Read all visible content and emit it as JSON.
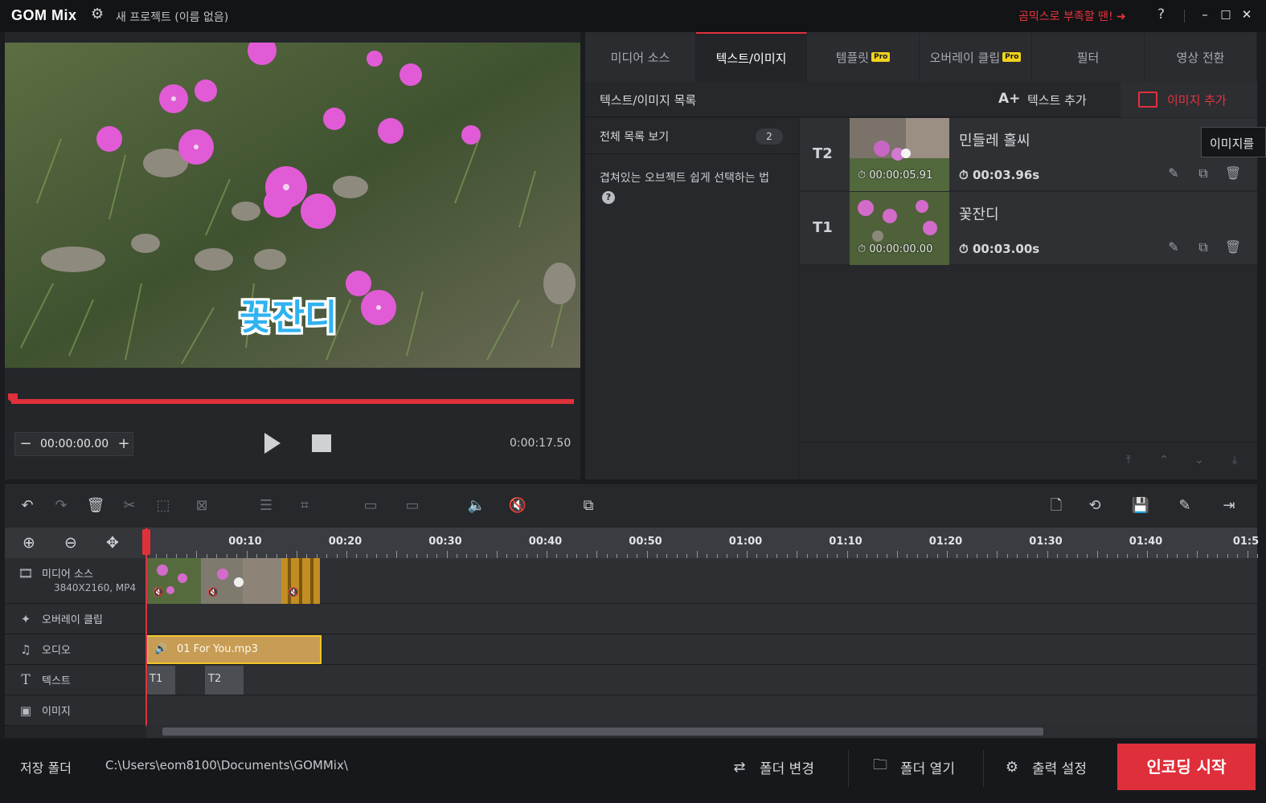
{
  "titlebar": {
    "logo": "GOM Mix",
    "project_title": "새 프로젝트 (이름 없음)",
    "promo_text": "곰믹스로 부족할 땐! ➜",
    "help": "?",
    "min": "–",
    "max": "□",
    "close": "✕"
  },
  "preview": {
    "caption": "꽃잔디",
    "timecode": "00:00:00.00",
    "tc_minus": "−",
    "tc_plus": "+",
    "duration": "0:00:17.50",
    "progress": 0.0
  },
  "tabs": [
    {
      "label": "미디어 소스",
      "pro": ""
    },
    {
      "label": "텍스트/이미지",
      "pro": ""
    },
    {
      "label": "템플릿",
      "pro": "Pro"
    },
    {
      "label": "오버레이 클립",
      "pro": "Pro"
    },
    {
      "label": "필터",
      "pro": ""
    },
    {
      "label": "영상 전환",
      "pro": ""
    }
  ],
  "list_panel": {
    "title": "텍스트/이미지 목록",
    "add_text_icon": "A+",
    "add_text": "텍스트 추가",
    "add_image": "이미지 추가",
    "tooltip": "이미지를",
    "all_list": "전체 목록 보기",
    "all_count": "2",
    "tip": "겹쳐있는 오브젝트 쉽게 선택하는 법",
    "tip_q": "?"
  },
  "items": [
    {
      "id": "T2",
      "name": "민들레 홀씨",
      "start": "00:00:05.91",
      "duration": "00:03.96s"
    },
    {
      "id": "T1",
      "name": "꽃잔디",
      "start": "00:00:00.00",
      "duration": "00:03.00s"
    }
  ],
  "ruler": {
    "labels": [
      "00:10",
      "00:20",
      "00:30",
      "00:40",
      "00:50",
      "01:00",
      "01:10",
      "01:20",
      "01:30",
      "01:40",
      "01:5"
    ]
  },
  "tracks": {
    "media": {
      "name": "미디어 소스",
      "sub": "3840X2160, MP4"
    },
    "overlay": {
      "name": "오버레이 클립"
    },
    "audio": {
      "name": "오디오",
      "clip": "01 For You.mp3"
    },
    "text": {
      "name": "텍스트",
      "clips": [
        "T1",
        "T2"
      ]
    },
    "image": {
      "name": "이미지"
    }
  },
  "bottombar": {
    "save_folder_label": "저장 폴더",
    "save_path": "C:\\Users\\eom8100\\Documents\\GOMMix\\",
    "change_folder": "폴더 변경",
    "open_folder": "폴더 열기",
    "output_settings": "출력 설정",
    "encode": "인코딩 시작"
  },
  "colors": {
    "accent": "#e0313b",
    "pro_badge": "#f2d21b",
    "audio_clip": "#c79d55",
    "caption_text": "#2fb2f0"
  }
}
